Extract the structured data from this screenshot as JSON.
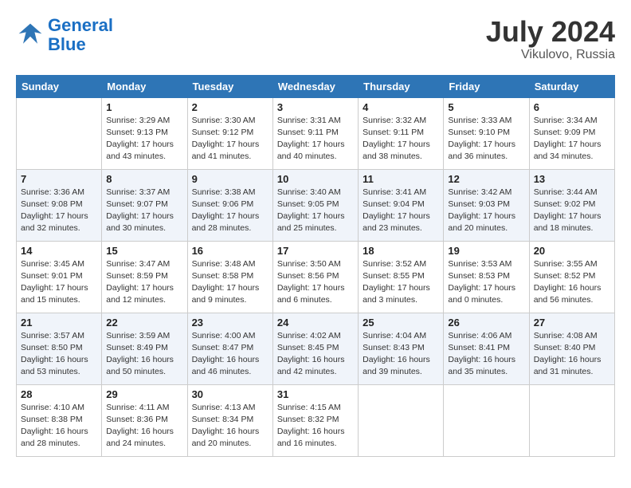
{
  "header": {
    "logo_line1": "General",
    "logo_line2": "Blue",
    "month_year": "July 2024",
    "location": "Vikulovo, Russia"
  },
  "weekdays": [
    "Sunday",
    "Monday",
    "Tuesday",
    "Wednesday",
    "Thursday",
    "Friday",
    "Saturday"
  ],
  "weeks": [
    [
      {
        "day": "",
        "info": ""
      },
      {
        "day": "1",
        "info": "Sunrise: 3:29 AM\nSunset: 9:13 PM\nDaylight: 17 hours\nand 43 minutes."
      },
      {
        "day": "2",
        "info": "Sunrise: 3:30 AM\nSunset: 9:12 PM\nDaylight: 17 hours\nand 41 minutes."
      },
      {
        "day": "3",
        "info": "Sunrise: 3:31 AM\nSunset: 9:11 PM\nDaylight: 17 hours\nand 40 minutes."
      },
      {
        "day": "4",
        "info": "Sunrise: 3:32 AM\nSunset: 9:11 PM\nDaylight: 17 hours\nand 38 minutes."
      },
      {
        "day": "5",
        "info": "Sunrise: 3:33 AM\nSunset: 9:10 PM\nDaylight: 17 hours\nand 36 minutes."
      },
      {
        "day": "6",
        "info": "Sunrise: 3:34 AM\nSunset: 9:09 PM\nDaylight: 17 hours\nand 34 minutes."
      }
    ],
    [
      {
        "day": "7",
        "info": "Sunrise: 3:36 AM\nSunset: 9:08 PM\nDaylight: 17 hours\nand 32 minutes."
      },
      {
        "day": "8",
        "info": "Sunrise: 3:37 AM\nSunset: 9:07 PM\nDaylight: 17 hours\nand 30 minutes."
      },
      {
        "day": "9",
        "info": "Sunrise: 3:38 AM\nSunset: 9:06 PM\nDaylight: 17 hours\nand 28 minutes."
      },
      {
        "day": "10",
        "info": "Sunrise: 3:40 AM\nSunset: 9:05 PM\nDaylight: 17 hours\nand 25 minutes."
      },
      {
        "day": "11",
        "info": "Sunrise: 3:41 AM\nSunset: 9:04 PM\nDaylight: 17 hours\nand 23 minutes."
      },
      {
        "day": "12",
        "info": "Sunrise: 3:42 AM\nSunset: 9:03 PM\nDaylight: 17 hours\nand 20 minutes."
      },
      {
        "day": "13",
        "info": "Sunrise: 3:44 AM\nSunset: 9:02 PM\nDaylight: 17 hours\nand 18 minutes."
      }
    ],
    [
      {
        "day": "14",
        "info": "Sunrise: 3:45 AM\nSunset: 9:01 PM\nDaylight: 17 hours\nand 15 minutes."
      },
      {
        "day": "15",
        "info": "Sunrise: 3:47 AM\nSunset: 8:59 PM\nDaylight: 17 hours\nand 12 minutes."
      },
      {
        "day": "16",
        "info": "Sunrise: 3:48 AM\nSunset: 8:58 PM\nDaylight: 17 hours\nand 9 minutes."
      },
      {
        "day": "17",
        "info": "Sunrise: 3:50 AM\nSunset: 8:56 PM\nDaylight: 17 hours\nand 6 minutes."
      },
      {
        "day": "18",
        "info": "Sunrise: 3:52 AM\nSunset: 8:55 PM\nDaylight: 17 hours\nand 3 minutes."
      },
      {
        "day": "19",
        "info": "Sunrise: 3:53 AM\nSunset: 8:53 PM\nDaylight: 17 hours\nand 0 minutes."
      },
      {
        "day": "20",
        "info": "Sunrise: 3:55 AM\nSunset: 8:52 PM\nDaylight: 16 hours\nand 56 minutes."
      }
    ],
    [
      {
        "day": "21",
        "info": "Sunrise: 3:57 AM\nSunset: 8:50 PM\nDaylight: 16 hours\nand 53 minutes."
      },
      {
        "day": "22",
        "info": "Sunrise: 3:59 AM\nSunset: 8:49 PM\nDaylight: 16 hours\nand 50 minutes."
      },
      {
        "day": "23",
        "info": "Sunrise: 4:00 AM\nSunset: 8:47 PM\nDaylight: 16 hours\nand 46 minutes."
      },
      {
        "day": "24",
        "info": "Sunrise: 4:02 AM\nSunset: 8:45 PM\nDaylight: 16 hours\nand 42 minutes."
      },
      {
        "day": "25",
        "info": "Sunrise: 4:04 AM\nSunset: 8:43 PM\nDaylight: 16 hours\nand 39 minutes."
      },
      {
        "day": "26",
        "info": "Sunrise: 4:06 AM\nSunset: 8:41 PM\nDaylight: 16 hours\nand 35 minutes."
      },
      {
        "day": "27",
        "info": "Sunrise: 4:08 AM\nSunset: 8:40 PM\nDaylight: 16 hours\nand 31 minutes."
      }
    ],
    [
      {
        "day": "28",
        "info": "Sunrise: 4:10 AM\nSunset: 8:38 PM\nDaylight: 16 hours\nand 28 minutes."
      },
      {
        "day": "29",
        "info": "Sunrise: 4:11 AM\nSunset: 8:36 PM\nDaylight: 16 hours\nand 24 minutes."
      },
      {
        "day": "30",
        "info": "Sunrise: 4:13 AM\nSunset: 8:34 PM\nDaylight: 16 hours\nand 20 minutes."
      },
      {
        "day": "31",
        "info": "Sunrise: 4:15 AM\nSunset: 8:32 PM\nDaylight: 16 hours\nand 16 minutes."
      },
      {
        "day": "",
        "info": ""
      },
      {
        "day": "",
        "info": ""
      },
      {
        "day": "",
        "info": ""
      }
    ]
  ]
}
